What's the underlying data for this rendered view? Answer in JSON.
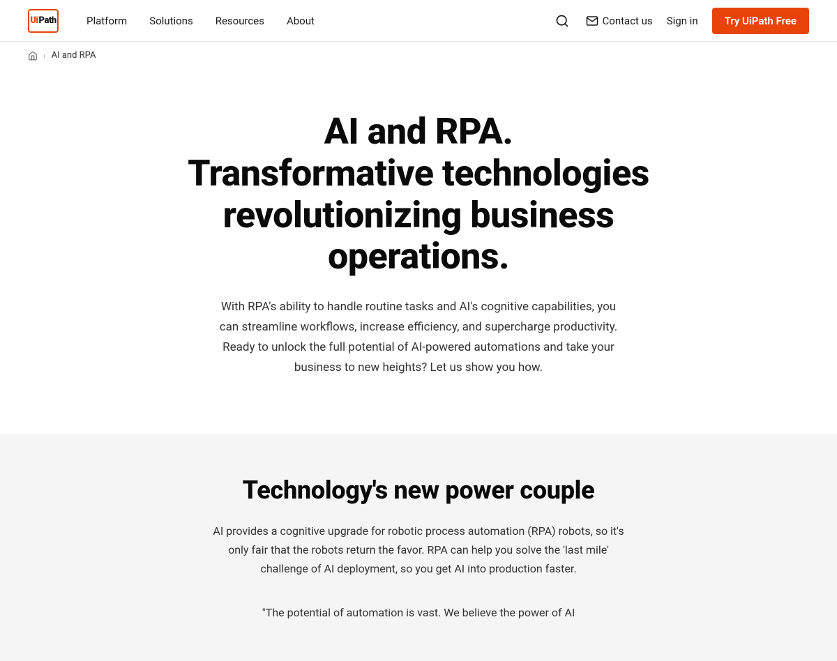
{
  "navbar": {
    "logo_ui": "Ui",
    "logo_path": "Path",
    "nav_items": [
      {
        "label": "Platform",
        "id": "platform"
      },
      {
        "label": "Solutions",
        "id": "solutions"
      },
      {
        "label": "Resources",
        "id": "resources"
      },
      {
        "label": "About",
        "id": "about"
      }
    ],
    "contact_label": "Contact us",
    "signin_label": "Sign in",
    "try_free_label": "Try UiPath Free"
  },
  "breadcrumb": {
    "home_label": "Home",
    "current_label": "AI and RPA"
  },
  "hero": {
    "title": "AI and RPA.\nTransformative technologies revolutionizing business operations.",
    "title_line1": "AI and RPA.",
    "title_line2": "Transformative technologies",
    "title_line3": "revolutionizing business",
    "title_line4": "operations.",
    "description": "With RPA's ability to handle routine tasks and AI's cognitive capabilities, you can streamline workflows, increase efficiency, and supercharge productivity. Ready to unlock the full potential of AI-powered automations and take your business to new heights? Let us show you how."
  },
  "technology_section": {
    "title": "Technology's new power couple",
    "description": "AI provides a cognitive upgrade for robotic process automation (RPA) robots, so it's only fair that the robots return the favor. RPA can help you solve the 'last mile' challenge of AI deployment, so you get AI into production faster."
  },
  "quote_section": {
    "text": "\"The potential of automation is vast. We believe the power of AI"
  },
  "colors": {
    "accent": "#e8440a",
    "text_dark": "#0a0a0a",
    "text_medium": "#333",
    "text_light": "#666",
    "bg_gray": "#f5f5f5"
  }
}
